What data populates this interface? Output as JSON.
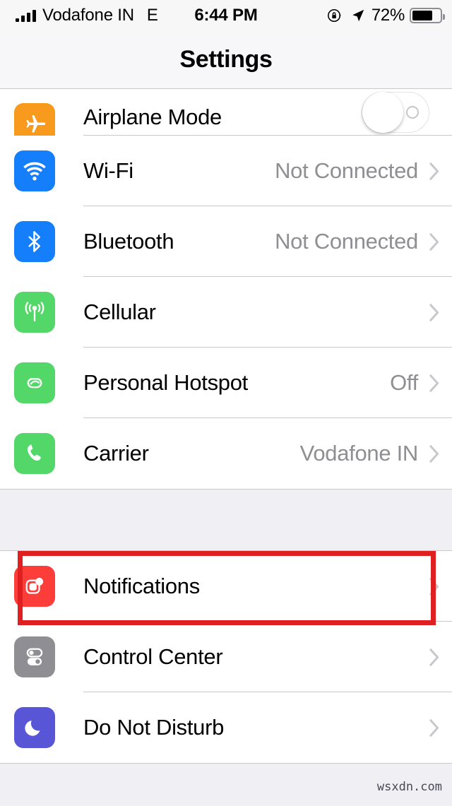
{
  "status_bar": {
    "carrier": "Vodafone IN",
    "network_type": "E",
    "time": "6:44 PM",
    "battery_percent": "72%",
    "signal_bars": 4,
    "icons": [
      "rotation-lock-icon",
      "location-arrow-icon",
      "battery-icon"
    ]
  },
  "header": {
    "title": "Settings"
  },
  "groups": [
    {
      "id": "connectivity",
      "rows": [
        {
          "label": "Airplane Mode",
          "value": "",
          "icon": "airplane-icon",
          "icon_color": "#F79A1D",
          "accessory": "switch",
          "switch_on": false,
          "clipped": true
        },
        {
          "label": "Wi-Fi",
          "value": "Not Connected",
          "icon": "wifi-icon",
          "icon_color": "#147EFB",
          "accessory": "chevron"
        },
        {
          "label": "Bluetooth",
          "value": "Not Connected",
          "icon": "bluetooth-icon",
          "icon_color": "#147EFB",
          "accessory": "chevron"
        },
        {
          "label": "Cellular",
          "value": "",
          "icon": "cellular-antenna-icon",
          "icon_color": "#53D769",
          "accessory": "chevron"
        },
        {
          "label": "Personal Hotspot",
          "value": "Off",
          "icon": "hotspot-link-icon",
          "icon_color": "#53D769",
          "accessory": "chevron"
        },
        {
          "label": "Carrier",
          "value": "Vodafone IN",
          "icon": "phone-handset-icon",
          "icon_color": "#53D769",
          "accessory": "chevron"
        }
      ]
    },
    {
      "id": "system",
      "rows": [
        {
          "label": "Notifications",
          "value": "",
          "icon": "notifications-badge-icon",
          "icon_color": "#FC3D39",
          "accessory": "chevron",
          "highlighted": true
        },
        {
          "label": "Control Center",
          "value": "",
          "icon": "control-center-toggles-icon",
          "icon_color": "#8E8E93",
          "accessory": "chevron"
        },
        {
          "label": "Do Not Disturb",
          "value": "",
          "icon": "moon-icon",
          "icon_color": "#5856D6",
          "accessory": "chevron"
        }
      ]
    }
  ],
  "annotation": {
    "type": "highlight-rectangle",
    "color": "#E02020",
    "target": "Notifications"
  },
  "watermark": {
    "text": "wsxdn.com"
  }
}
